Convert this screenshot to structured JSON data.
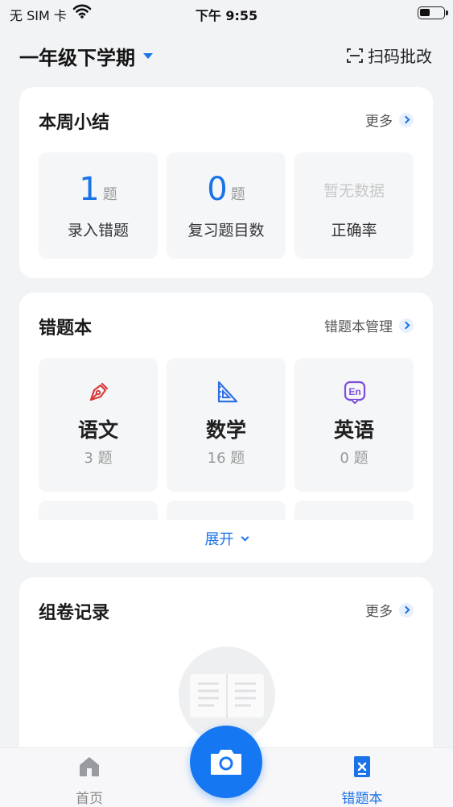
{
  "status_bar": {
    "carrier": "无 SIM 卡",
    "time": "下午 9:55"
  },
  "header": {
    "semester": "一年级下学期",
    "scan_label": "扫码批改"
  },
  "weekly_summary": {
    "title": "本周小结",
    "more": "更多",
    "stats": [
      {
        "value": "1",
        "unit": "题",
        "label": "录入错题"
      },
      {
        "value": "0",
        "unit": "题",
        "label": "复习题目数"
      },
      {
        "empty_text": "暂无数据",
        "label": "正确率"
      }
    ]
  },
  "wrong_book": {
    "title": "错题本",
    "manage": "错题本管理",
    "subjects": [
      {
        "name": "语文",
        "count": "3 题",
        "icon": "pen-nib-icon",
        "color": "#d93a3a"
      },
      {
        "name": "数学",
        "count": "16 题",
        "icon": "set-square-icon",
        "color": "#2f6fe4"
      },
      {
        "name": "英语",
        "count": "0 题",
        "icon": "english-icon",
        "color": "#7c4dde"
      }
    ],
    "expand": "展开"
  },
  "paper_records": {
    "title": "组卷记录",
    "more": "更多"
  },
  "tab_bar": {
    "home": "首页",
    "wrong_book": "错题本",
    "active": "wrong_book",
    "accent": "#1a73e8"
  }
}
